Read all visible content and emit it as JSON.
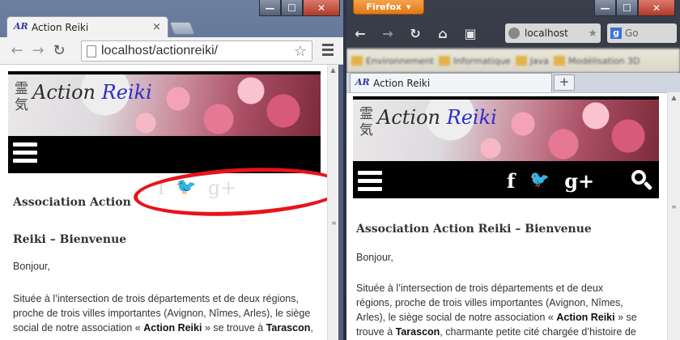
{
  "chrome": {
    "tab_title": "Action Reiki",
    "tab_close": "×",
    "url": "localhost/actionreiki/",
    "win_min": "—",
    "win_max": "☐",
    "win_close": "✕",
    "site": {
      "kanji": "霊 気",
      "brand_action": "Action",
      "brand_reiki": "Reiki",
      "social": [
        "f",
        "🐦",
        "g+"
      ],
      "heading_line1": "Association Action",
      "heading_line2": "Reiki – Bienvenue",
      "greeting": "Bonjour,",
      "para_line1": "Située à l’intersection de trois départements et de deux régions,",
      "para_line2": "proche de trois villes importantes (Avignon, Nîmes, Arles), le siège",
      "para_line3_pre": "social de notre association « ",
      "para_line3_b1": "Action Reiki",
      "para_line3_mid": " » se trouve à ",
      "para_line3_b2": "Tarascon",
      "para_line3_post": ","
    }
  },
  "firefox": {
    "menu_label": "Firefox",
    "url": "localhost",
    "search_placeholder": "Go",
    "search_engine": "g",
    "tab_title": "Action Reiki",
    "new_tab": "+",
    "win_min": "—",
    "win_max": "☐",
    "win_close": "✕",
    "bookmarks": [
      "Environnement",
      "Informatique",
      "Java",
      "Modélisation 3D"
    ],
    "site": {
      "kanji": "霊 気",
      "brand_action": "Action",
      "brand_reiki": "Reiki",
      "social": [
        "f",
        "🐦",
        "g+"
      ],
      "heading": "Association Action Reiki – Bienvenue",
      "greeting": "Bonjour,",
      "para_line1": "Située à l’intersection de trois départements et de deux",
      "para_line2": "régions, proche de trois villes importantes (Avignon, Nîmes,",
      "para_line3_pre": "Arles), le siège social de notre association « ",
      "para_line3_b": "Action Reiki",
      "para_line3_post": " » se",
      "para_line4_pre": "trouve à ",
      "para_line4_b": "Tarascon",
      "para_line4_post": ", charmante petite cité chargée d’histoire de"
    }
  },
  "colors": {
    "annotation_circle": "#e8131b",
    "firefox_orange": "#e07915",
    "reiki_blue": "#2d2dc8"
  }
}
